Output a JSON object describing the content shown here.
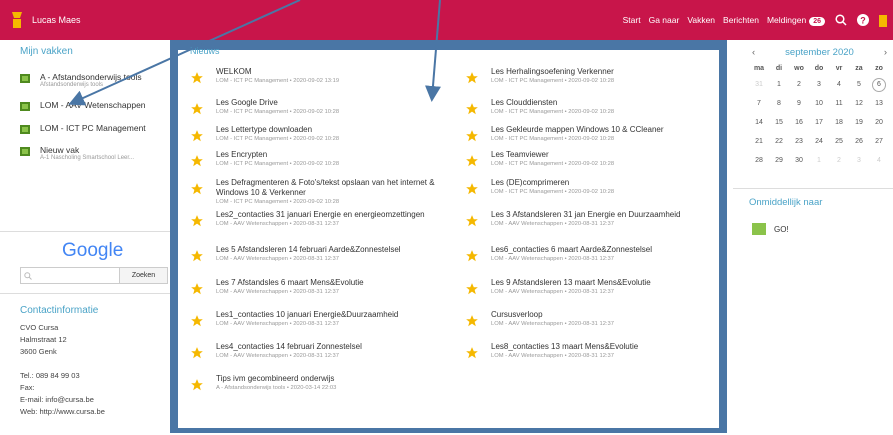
{
  "topbar": {
    "user": "Lucas Maes",
    "nav": [
      "Start",
      "Ga naar",
      "Vakken",
      "Berichten",
      "Meldingen"
    ],
    "notifications_count": "26"
  },
  "courses": {
    "title": "Mijn vakken",
    "items": [
      {
        "label": "A - Afstandsonderwijs tools",
        "sub": "Afstandsonderwijs tools"
      },
      {
        "label": "LOM - AAV Wetenschappen",
        "sub": ""
      },
      {
        "label": "LOM - ICT PC Management",
        "sub": ""
      },
      {
        "label": "Nieuw vak",
        "sub": "A-1 Nascholing Smartschool Leer..."
      }
    ]
  },
  "google": {
    "logo": "Google",
    "button": "Zoeken",
    "placeholder": ""
  },
  "contact": {
    "title": "Contactinformatie",
    "lines": [
      "CVO Cursa",
      "Halmstraat 12",
      "3600 Genk",
      "",
      "Tel.: 089 84 99 03",
      "Fax:",
      "E-mail: info@cursa.be",
      "Web: http://www.cursa.be"
    ]
  },
  "news": {
    "title": "Nieuws",
    "items": [
      {
        "title": "WELKOM",
        "meta": "LOM - ICT PC Management • 2020-09-02 13:19"
      },
      {
        "title": "Les Herhalingsoefening Verkenner",
        "meta": "LOM - ICT PC Management • 2020-09-02 10:28"
      },
      {
        "title": "Les Google Drive",
        "meta": "LOM - ICT PC Management • 2020-09-02 10:28"
      },
      {
        "title": "Les Clouddiensten",
        "meta": "LOM - ICT PC Management • 2020-09-02 10:28"
      },
      {
        "title": "Les Lettertype downloaden",
        "meta": "LOM - ICT PC Management • 2020-09-02 10:28"
      },
      {
        "title": "Les Gekleurde mappen Windows 10 & CCleaner",
        "meta": "LOM - ICT PC Management • 2020-09-02 10:28"
      },
      {
        "title": "Les Encrypten",
        "meta": "LOM - ICT PC Management • 2020-09-02 10:28"
      },
      {
        "title": "Les Teamviewer",
        "meta": "LOM - ICT PC Management • 2020-09-02 10:28"
      },
      {
        "title": "Les Defragmenteren & Foto's/tekst opslaan van het internet & Windows 10 & Verkenner",
        "meta": "LOM - ICT PC Management • 2020-09-02 10:28"
      },
      {
        "title": "Les (DE)comprimeren",
        "meta": "LOM - ICT PC Management • 2020-09-02 10:28"
      },
      {
        "title": "Les2_contacties 31 januari Energie en energieomzettingen",
        "meta": "LOM - AAV Wetenschappen • 2020-08-31 12:37"
      },
      {
        "title": "Les 3 Afstandsleren 31 jan Energie en Duurzaamheid",
        "meta": "LOM - AAV Wetenschappen • 2020-08-31 12:37"
      },
      {
        "title": "Les 5 Afstandsleren 14 februari Aarde&Zonnestelsel",
        "meta": "LOM - AAV Wetenschappen • 2020-08-31 12:37"
      },
      {
        "title": "Les6_contacties 6 maart Aarde&Zonnestelsel",
        "meta": "LOM - AAV Wetenschappen • 2020-08-31 12:37"
      },
      {
        "title": "Les 7 Afstandsles 6 maart Mens&Evolutie",
        "meta": "LOM - AAV Wetenschappen • 2020-08-31 12:37"
      },
      {
        "title": "Les 9 Afstandsleren 13 maart Mens&Evolutie",
        "meta": "LOM - AAV Wetenschappen • 2020-08-31 12:37"
      },
      {
        "title": "Les1_contacties 10 januari Energie&Duurzaamheid",
        "meta": "LOM - AAV Wetenschappen • 2020-08-31 12:37"
      },
      {
        "title": "Cursusverloop",
        "meta": "LOM - AAV Wetenschappen • 2020-08-31 12:37"
      },
      {
        "title": "Les4_contacties 14 februari Zonnestelsel",
        "meta": "LOM - AAV Wetenschappen • 2020-08-31 12:37"
      },
      {
        "title": "Les8_contacties 13 maart Mens&Evolutie",
        "meta": "LOM - AAV Wetenschappen • 2020-08-31 12:37"
      },
      {
        "title": "Tips ivm gecombineerd onderwijs",
        "meta": "A - Afstandsonderwijs tools • 2020-03-14 22:03"
      }
    ]
  },
  "calendar": {
    "month": "september 2020",
    "prev": "‹",
    "next": "›",
    "dow": [
      "ma",
      "di",
      "wo",
      "do",
      "vr",
      "za",
      "zo"
    ],
    "weeks": [
      [
        "31",
        "1",
        "2",
        "3",
        "4",
        "5",
        "6"
      ],
      [
        "7",
        "8",
        "9",
        "10",
        "11",
        "12",
        "13"
      ],
      [
        "14",
        "15",
        "16",
        "17",
        "18",
        "19",
        "20"
      ],
      [
        "21",
        "22",
        "23",
        "24",
        "25",
        "26",
        "27"
      ],
      [
        "28",
        "29",
        "30",
        "1",
        "2",
        "3",
        "4"
      ]
    ]
  },
  "quick": {
    "title": "Onmiddellijk naar",
    "item": "GO!"
  },
  "colors": {
    "brand": "#c8154a",
    "accent": "#4aa3c7",
    "frame": "#4a76a5",
    "star": "#f5b800"
  }
}
